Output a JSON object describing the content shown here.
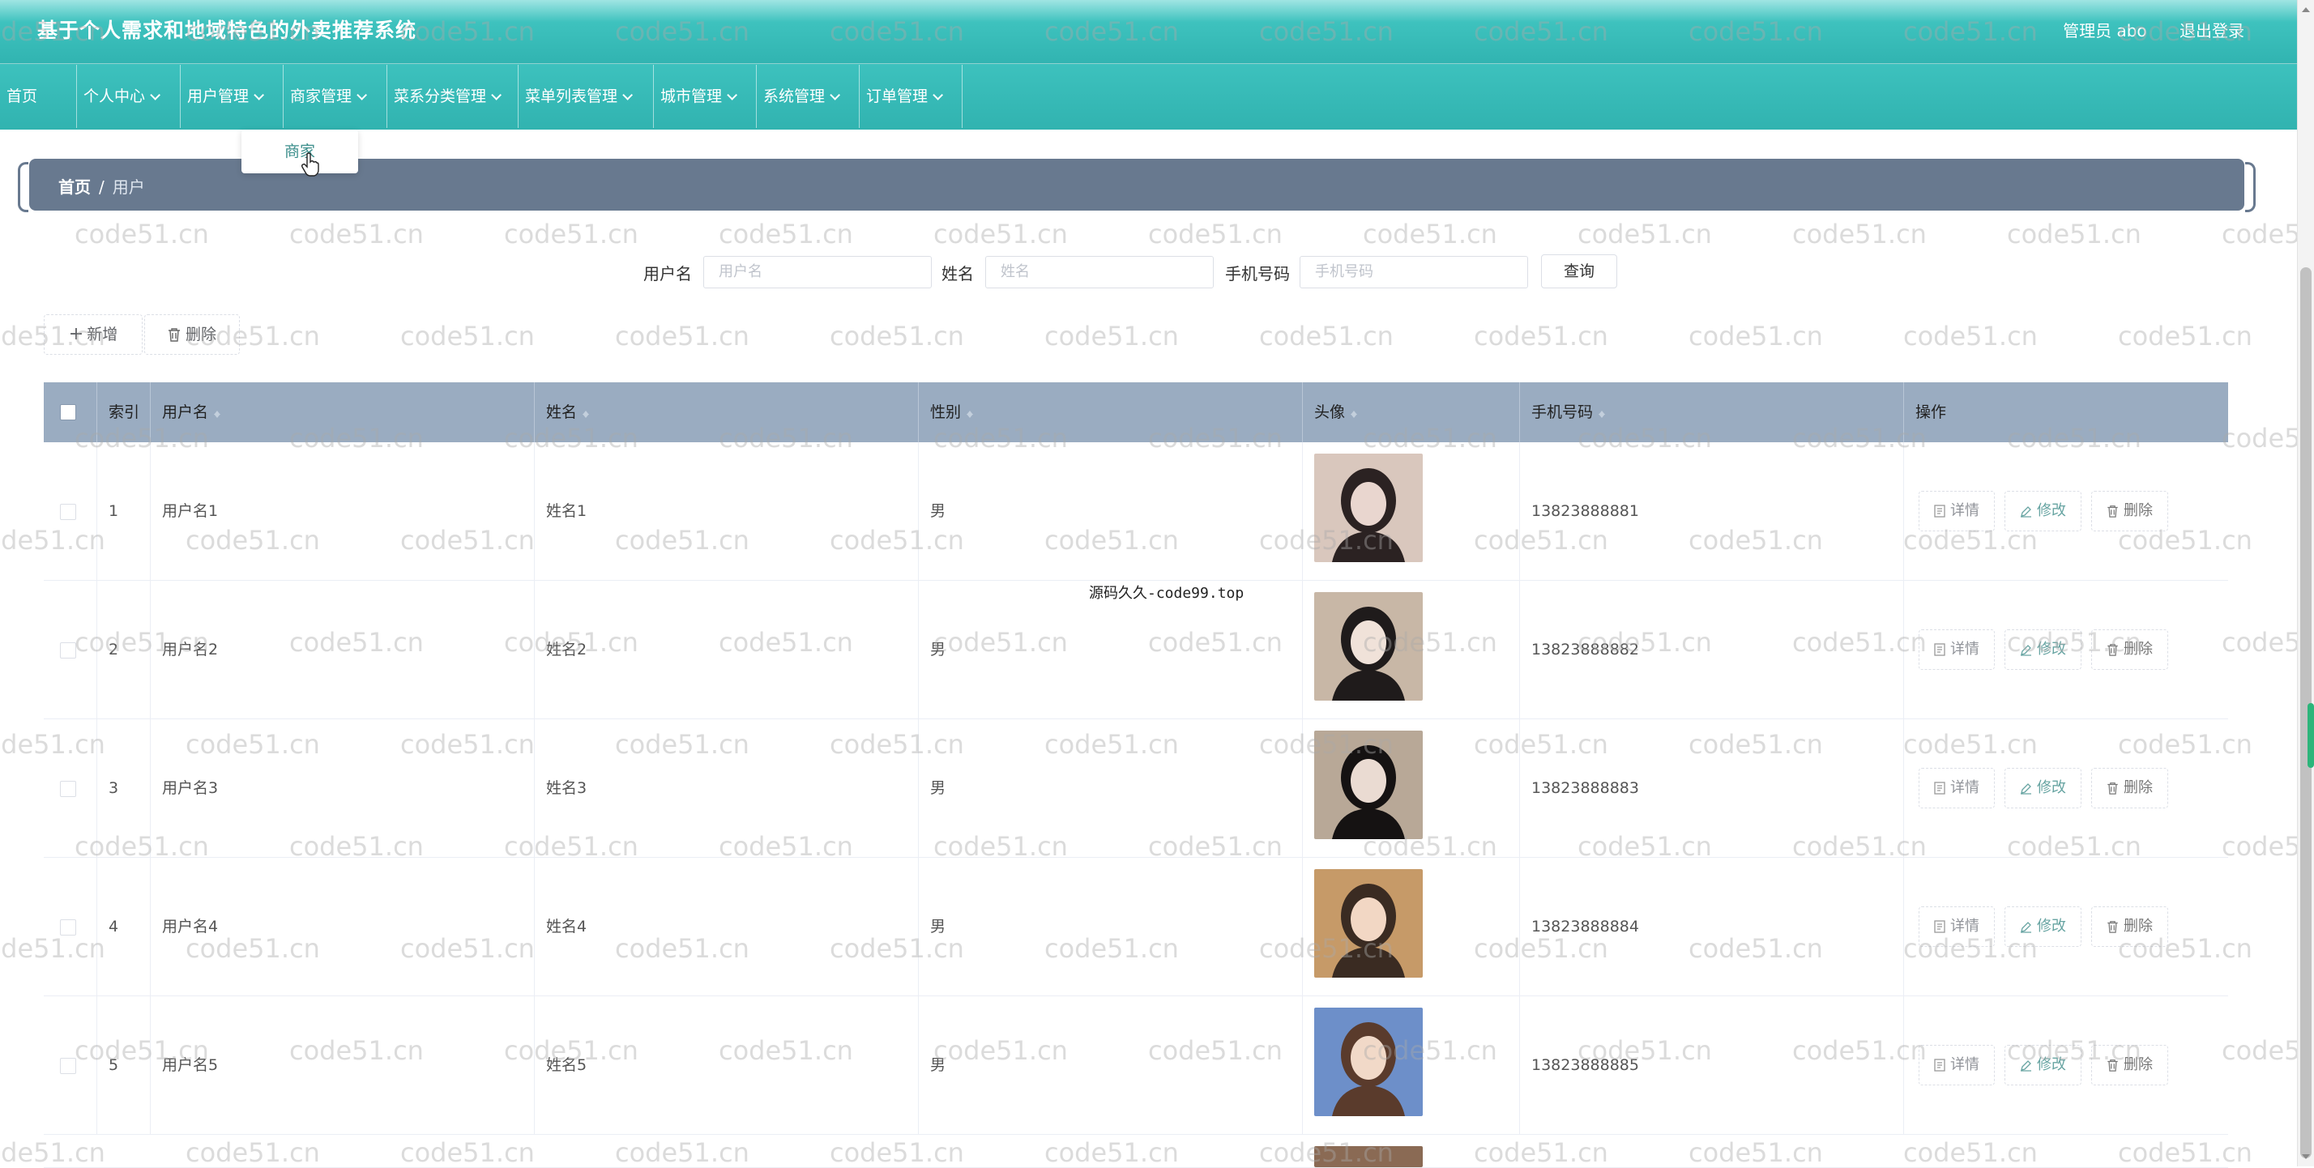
{
  "app": {
    "title": "基于个人需求和地域特色的外卖推荐系统",
    "user_label": "管理员 abo",
    "logout": "退出登录"
  },
  "nav": {
    "items": [
      {
        "label": "首页",
        "dropdown": false
      },
      {
        "label": "个人中心",
        "dropdown": true
      },
      {
        "label": "用户管理",
        "dropdown": true
      },
      {
        "label": "商家管理",
        "dropdown": true
      },
      {
        "label": "菜系分类管理",
        "dropdown": true
      },
      {
        "label": "菜单列表管理",
        "dropdown": true
      },
      {
        "label": "城市管理",
        "dropdown": true
      },
      {
        "label": "系统管理",
        "dropdown": true
      },
      {
        "label": "订单管理",
        "dropdown": true
      }
    ],
    "open_dropdown_item": "商家"
  },
  "breadcrumb": {
    "home": "首页",
    "separator": "/",
    "current": "用户"
  },
  "search": {
    "username_label": "用户名",
    "username_placeholder": "用户名",
    "name_label": "姓名",
    "name_placeholder": "姓名",
    "phone_label": "手机号码",
    "phone_placeholder": "手机号码",
    "query_button": "查询"
  },
  "toolbar": {
    "add": "新增",
    "delete": "删除"
  },
  "table": {
    "headers": {
      "index": "索引",
      "username": "用户名",
      "name": "姓名",
      "gender": "性别",
      "avatar": "头像",
      "phone": "手机号码",
      "actions": "操作"
    },
    "rows": [
      {
        "index": "1",
        "username": "用户名1",
        "name": "姓名1",
        "gender": "男",
        "phone": "13823888881"
      },
      {
        "index": "2",
        "username": "用户名2",
        "name": "姓名2",
        "gender": "男",
        "phone": "13823888882"
      },
      {
        "index": "3",
        "username": "用户名3",
        "name": "姓名3",
        "gender": "男",
        "phone": "13823888883"
      },
      {
        "index": "4",
        "username": "用户名4",
        "name": "姓名4",
        "gender": "男",
        "phone": "13823888884"
      },
      {
        "index": "5",
        "username": "用户名5",
        "name": "姓名5",
        "gender": "男",
        "phone": "13823888885"
      }
    ],
    "row_actions": {
      "detail": "详情",
      "edit": "修改",
      "delete": "删除"
    }
  },
  "overlay_text": "源码久久-code99.top",
  "watermark": "code51.cn",
  "colors": {
    "header_teal": "#31b4b1",
    "breadcrumb_bg": "#68798f",
    "table_header_bg": "#9aacc1",
    "edit_accent": "#67a4a2"
  }
}
